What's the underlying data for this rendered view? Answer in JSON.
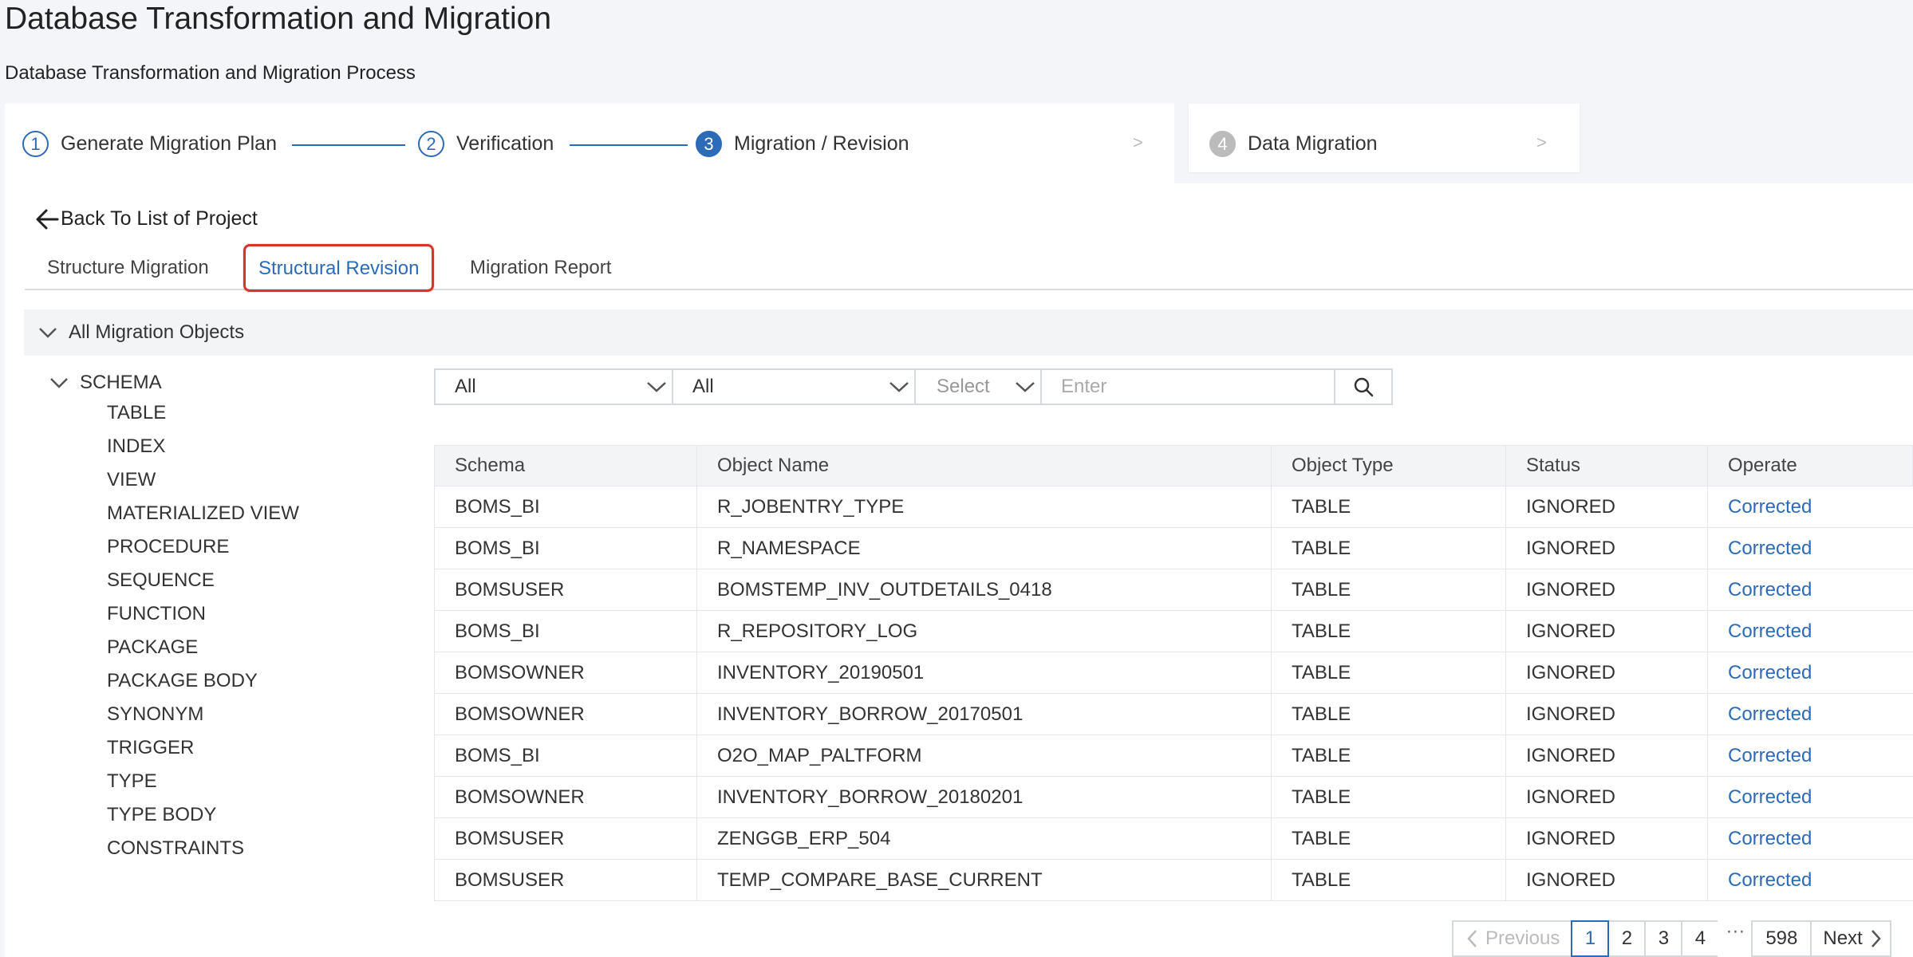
{
  "page": {
    "title": "Database Transformation and Migration",
    "subtitle": "Database Transformation and Migration Process"
  },
  "stepper": {
    "steps": [
      {
        "number": "1",
        "label": "Generate Migration Plan",
        "state": "done"
      },
      {
        "number": "2",
        "label": "Verification",
        "state": "done"
      },
      {
        "number": "3",
        "label": "Migration / Revision",
        "state": "active"
      },
      {
        "number": "4",
        "label": "Data Migration",
        "state": "disabled"
      }
    ],
    "chevron": ">"
  },
  "back_link": "Back To List of Project",
  "tabs": [
    {
      "label": "Structure Migration",
      "active": false
    },
    {
      "label": "Structural Revision",
      "active": true
    },
    {
      "label": "Migration Report",
      "active": false
    }
  ],
  "section": {
    "title": "All Migration Objects"
  },
  "tree": {
    "root": "SCHEMA",
    "items": [
      "TABLE",
      "INDEX",
      "VIEW",
      "MATERIALIZED VIEW",
      "PROCEDURE",
      "SEQUENCE",
      "FUNCTION",
      "PACKAGE",
      "PACKAGE BODY",
      "SYNONYM",
      "TRIGGER",
      "TYPE",
      "TYPE BODY",
      "CONSTRAINTS"
    ]
  },
  "filters": {
    "filter1": "All",
    "filter2": "All",
    "filter3_placeholder": "Select",
    "search_placeholder": "Enter"
  },
  "table": {
    "headers": [
      "Schema",
      "Object Name",
      "Object Type",
      "Status",
      "Operate"
    ],
    "rows": [
      [
        "BOMS_BI",
        "R_JOBENTRY_TYPE",
        "TABLE",
        "IGNORED",
        "Corrected"
      ],
      [
        "BOMS_BI",
        "R_NAMESPACE",
        "TABLE",
        "IGNORED",
        "Corrected"
      ],
      [
        "BOMSUSER",
        "BOMSTEMP_INV_OUTDETAILS_0418",
        "TABLE",
        "IGNORED",
        "Corrected"
      ],
      [
        "BOMS_BI",
        "R_REPOSITORY_LOG",
        "TABLE",
        "IGNORED",
        "Corrected"
      ],
      [
        "BOMSOWNER",
        "INVENTORY_20190501",
        "TABLE",
        "IGNORED",
        "Corrected"
      ],
      [
        "BOMSOWNER",
        "INVENTORY_BORROW_20170501",
        "TABLE",
        "IGNORED",
        "Corrected"
      ],
      [
        "BOMS_BI",
        "O2O_MAP_PALTFORM",
        "TABLE",
        "IGNORED",
        "Corrected"
      ],
      [
        "BOMSOWNER",
        "INVENTORY_BORROW_20180201",
        "TABLE",
        "IGNORED",
        "Corrected"
      ],
      [
        "BOMSUSER",
        "ZENGGB_ERP_504",
        "TABLE",
        "IGNORED",
        "Corrected"
      ],
      [
        "BOMSUSER",
        "TEMP_COMPARE_BASE_CURRENT",
        "TABLE",
        "IGNORED",
        "Corrected"
      ]
    ]
  },
  "pagination": {
    "previous": "Previous",
    "pages": [
      "1",
      "2",
      "3",
      "4"
    ],
    "ellipsis": "···",
    "last": "598",
    "next": "Next",
    "current": "1"
  },
  "colors": {
    "accent": "#2b6bb8",
    "highlight": "#d9342b"
  }
}
